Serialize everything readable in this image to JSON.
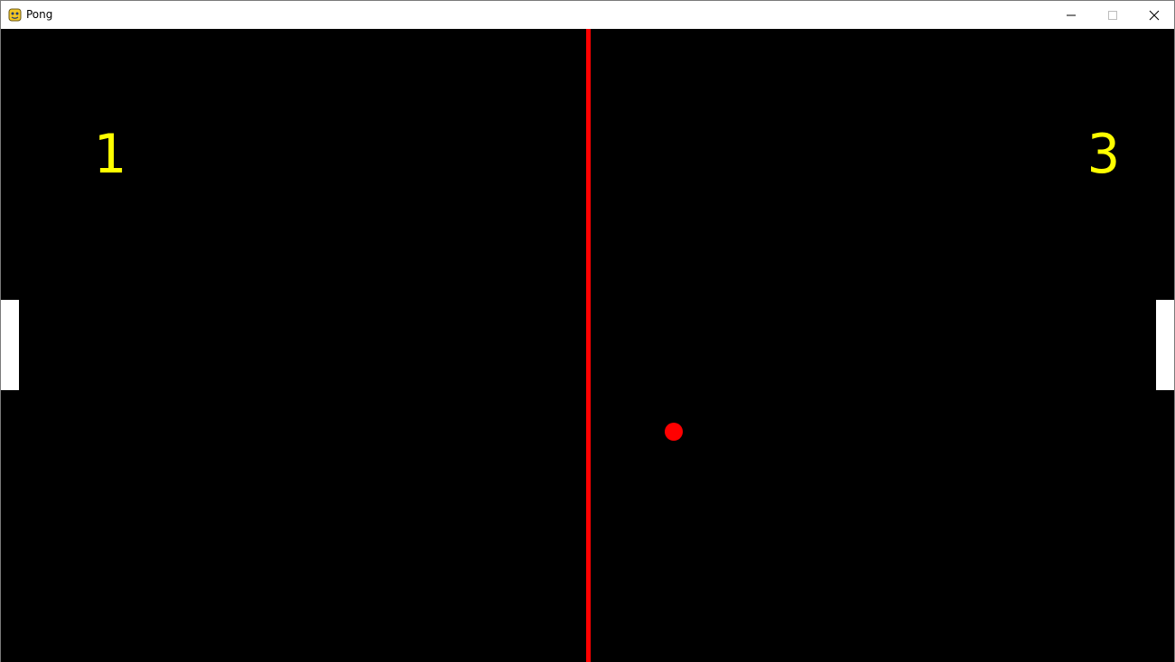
{
  "window": {
    "title": "Pong",
    "icon": "pygame-snake-icon",
    "controls": {
      "minimize_icon": "minimize-icon",
      "maximize_icon": "maximize-icon",
      "close_icon": "close-icon"
    }
  },
  "game": {
    "background_color": "#000000",
    "center_line_color": "#ff0000",
    "score_color": "#ffff00",
    "paddle_color": "#ffffff",
    "ball_color": "#ff0000",
    "score_left": "1",
    "score_right": "3"
  }
}
